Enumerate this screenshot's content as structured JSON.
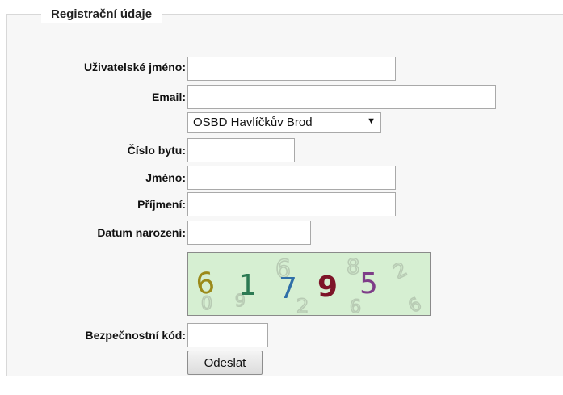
{
  "legend": "Registrační údaje",
  "fields": {
    "username_label": "Uživatelské jméno:",
    "email_label": "Email:",
    "apartment_label": "Číslo bytu:",
    "first_name_label": "Jméno:",
    "last_name_label": "Příjmení:",
    "birthdate_label": "Datum narození:",
    "security_code_label": "Bezpečnostní kód:"
  },
  "organization_select": {
    "selected": "OSBD Havlíčkův Brod"
  },
  "captcha": {
    "digits": [
      "6",
      "1",
      "7",
      "9",
      "5"
    ]
  },
  "submit_label": "Odeslat"
}
